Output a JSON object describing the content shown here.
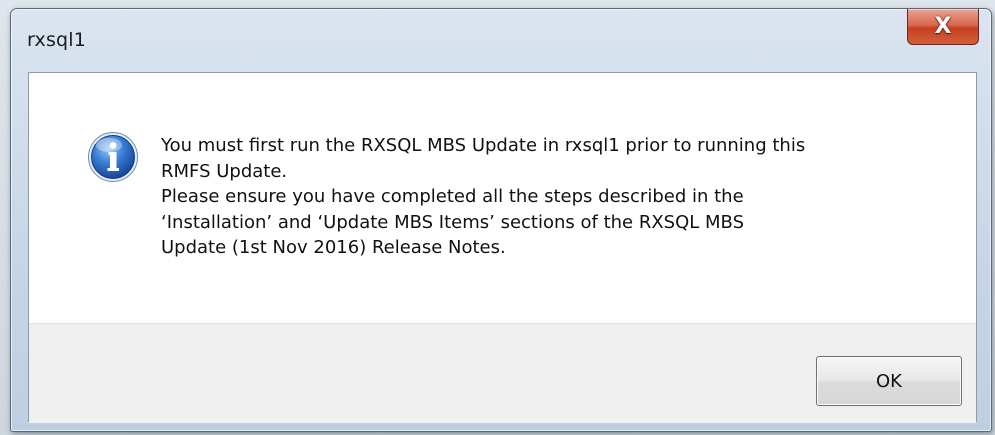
{
  "window": {
    "title": "rxsql1",
    "close_label": "X"
  },
  "dialog": {
    "icon": "info-icon",
    "message_lines": [
      "You must first run the RXSQL MBS Update in rxsql1 prior to running this",
      "RMFS Update.",
      "Please ensure you have completed all the steps described in the",
      "‘Installation’ and ‘Update MBS Items’ sections of the RXSQL MBS",
      "Update (1st Nov 2016) Release Notes."
    ],
    "ok_label": "OK"
  },
  "colors": {
    "close_button": "#c7401f",
    "info_icon": "#1f5fb8",
    "footer": "#f0f0f0"
  }
}
